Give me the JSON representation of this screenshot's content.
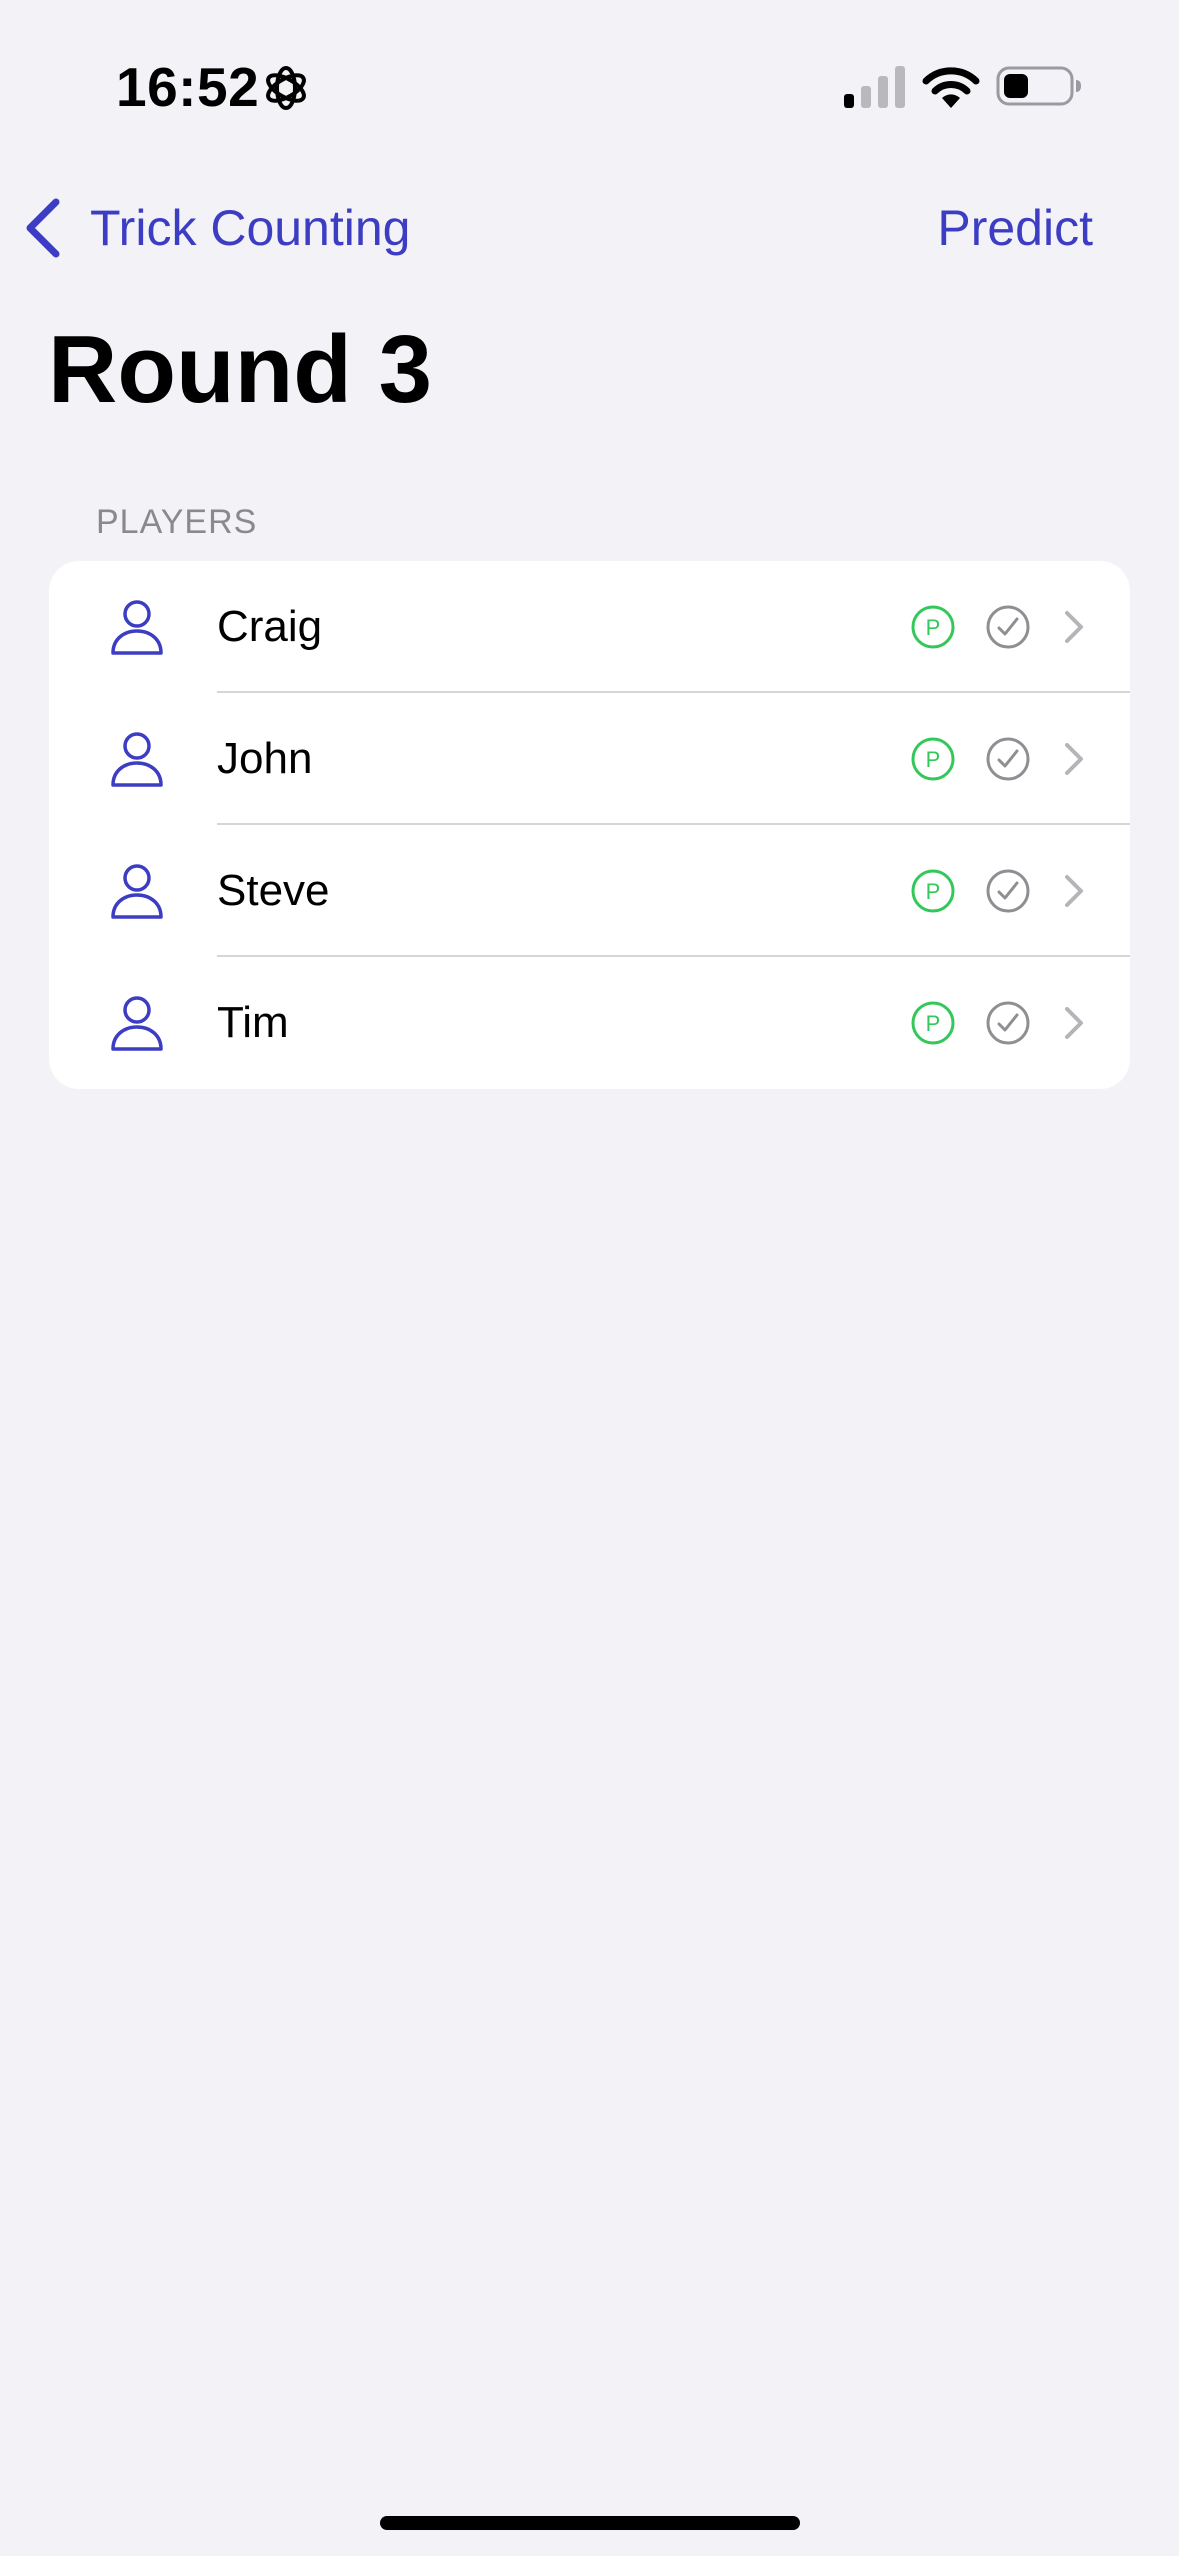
{
  "status_bar": {
    "time": "16:52",
    "focus_icon": "focus-flower-icon",
    "signal_icon": "cellular-signal-icon",
    "wifi_icon": "wifi-icon",
    "battery_icon": "battery-icon"
  },
  "nav": {
    "back_label": "Trick Counting",
    "action_label": "Predict"
  },
  "page": {
    "title": "Round 3"
  },
  "players_section": {
    "header": "PLAYERS",
    "players": [
      {
        "name": "Craig",
        "prediction_badge": "P"
      },
      {
        "name": "John",
        "prediction_badge": "P"
      },
      {
        "name": "Steve",
        "prediction_badge": "P"
      },
      {
        "name": "Tim",
        "prediction_badge": "P"
      }
    ]
  },
  "colors": {
    "accent": "#3d3dc4",
    "prediction_green": "#34c759",
    "checkmark_gray": "#8e8e93",
    "background": "#f2f2f7"
  }
}
